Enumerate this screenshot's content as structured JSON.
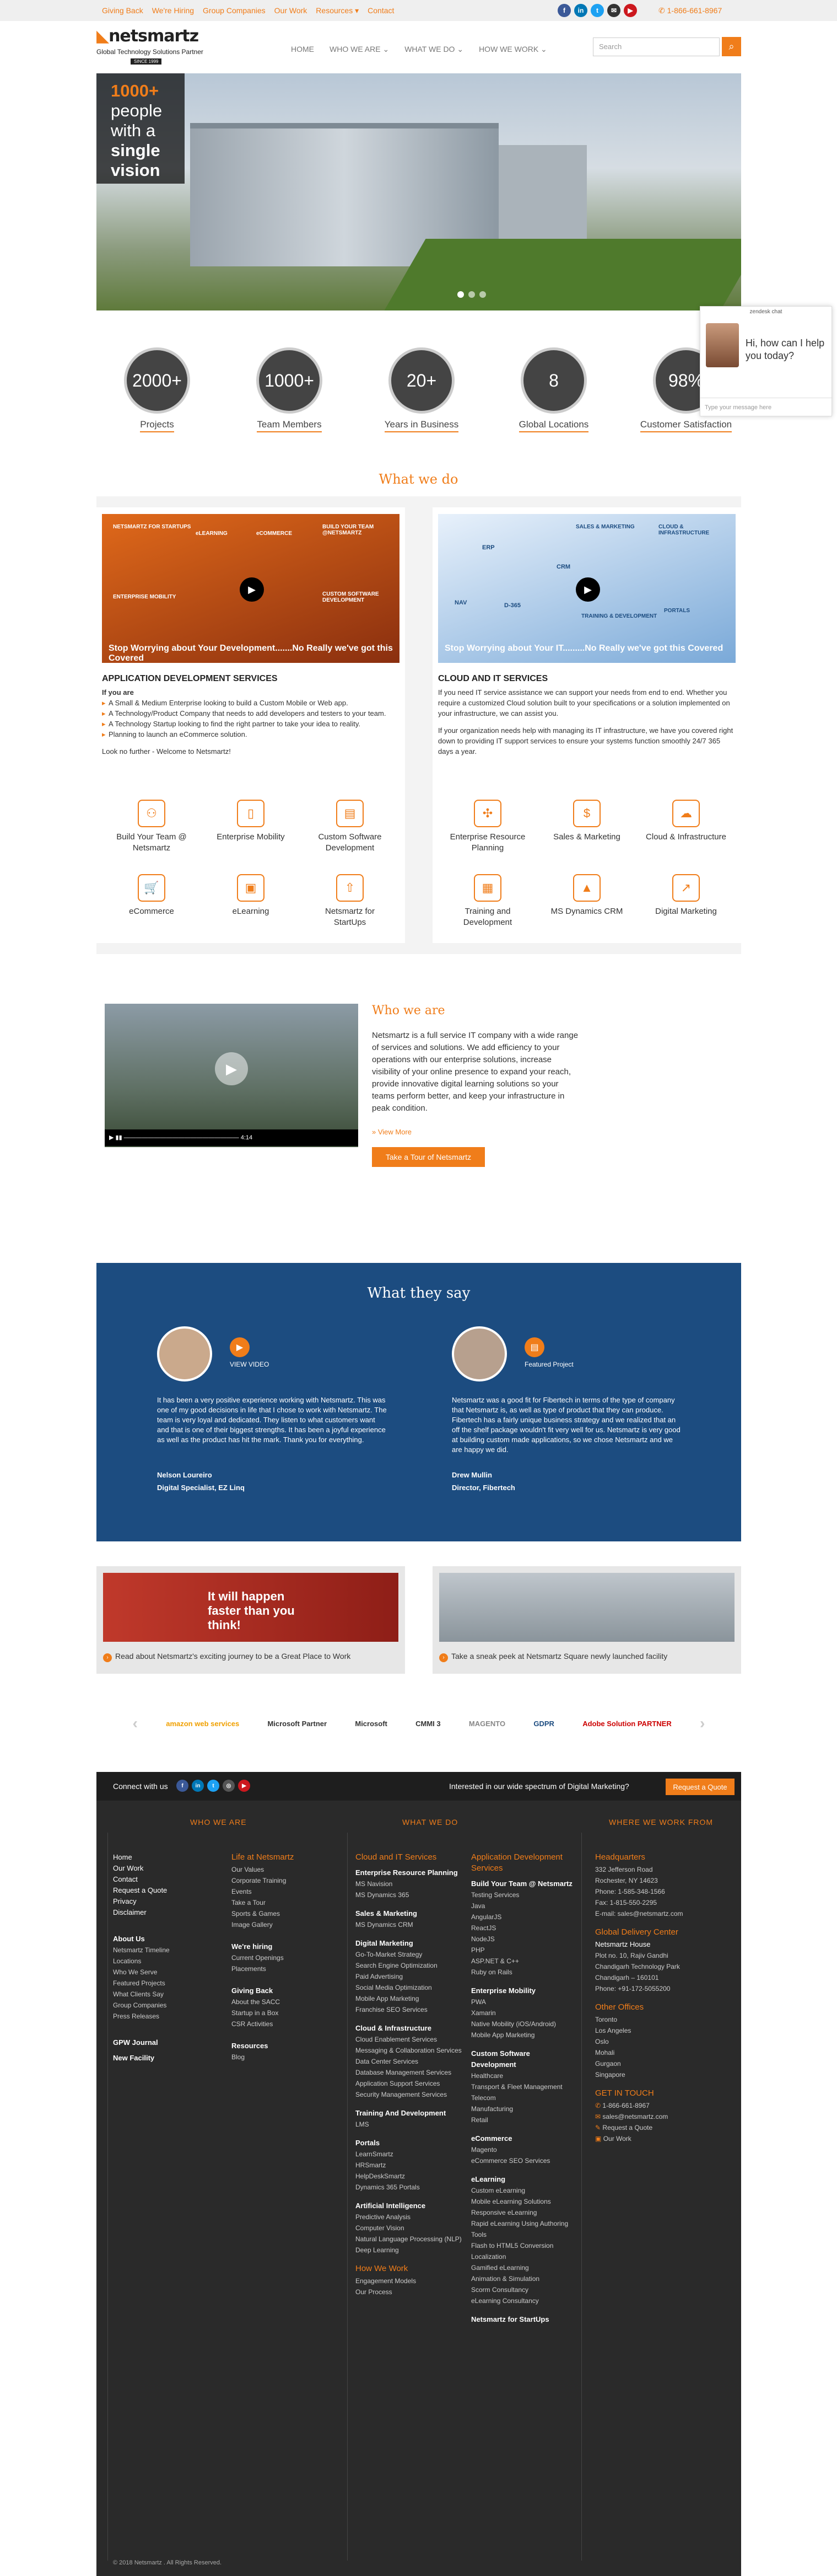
{
  "topbar": {
    "links": [
      "Giving Back",
      "We're Hiring",
      "Group Companies",
      "Our Work",
      "Resources ▾",
      "Contact"
    ],
    "phone": "1-866-661-8967",
    "social": [
      "f",
      "in",
      "t",
      "✉",
      "▶"
    ]
  },
  "header": {
    "logo_name": "netsmartz",
    "logo_tag": "Global Technology Solutions Partner",
    "logo_since": "SINCE 1999",
    "nav": [
      "HOME",
      "WHO WE ARE ⌄",
      "WHAT WE DO ⌄",
      "HOW WE WORK ⌄"
    ],
    "search_placeholder": "Search"
  },
  "hero": {
    "caption_line1": "1000+",
    "caption_rest": "people with a",
    "caption_bold": "single vision"
  },
  "stats": [
    {
      "value": "2000+",
      "label": "Projects"
    },
    {
      "value": "1000+",
      "label": "Team Members"
    },
    {
      "value": "20+",
      "label": "Years in Business"
    },
    {
      "value": "8",
      "label": "Global Locations"
    },
    {
      "value": "98%",
      "label": "Customer Satisfaction"
    }
  ],
  "chat": {
    "header": "zendesk chat",
    "message": "Hi, how can I help you today?",
    "input_placeholder": "Type your message here"
  },
  "what_we_do": {
    "title": "What we do",
    "left": {
      "video_title": "Stop Worrying about Your Development.......No Really we've got this Covered",
      "video_labels": [
        "NETSMARTZ FOR STARTUPS",
        "eLEARNING",
        "eCOMMERCE",
        "BUILD YOUR TEAM @NETSMARTZ",
        "ENTERPRISE MOBILITY",
        "CUSTOM SOFTWARE DEVELOPMENT"
      ],
      "heading": "APPLICATION DEVELOPMENT SERVICES",
      "if_you_are": "If you are",
      "bullets": [
        "A Small & Medium Enterprise looking to build a Custom Mobile or Web app.",
        "A Technology/Product Company that needs to add developers and testers to your team.",
        "A Technology Startup looking to find the right partner to take your idea to reality.",
        "Planning to launch an eCommerce solution."
      ],
      "look": "Look no further - Welcome to Netsmartz!",
      "services": [
        "Build Your Team @ Netsmartz",
        "Enterprise Mobility",
        "Custom Software Development",
        "eCommerce",
        "eLearning",
        "Netsmartz for StartUps"
      ]
    },
    "right": {
      "video_title": "Stop Worrying about Your IT.........No Really we've got this Covered",
      "video_labels": [
        "SALES & MARKETING",
        "CLOUD & INFRASTRUCTURE",
        "ERP",
        "CRM",
        "NAV",
        "D-365",
        "TRAINING & DEVELOPMENT",
        "PORTALS"
      ],
      "heading": "CLOUD AND IT SERVICES",
      "desc": "If you need IT service assistance we can support your needs from end to end. Whether you require a customized Cloud solution built to your specifications or a solution implemented on your infrastructure, we can assist you.",
      "desc2": "If your organization needs help with managing its IT infrastructure, we have you covered right down to providing IT support services to ensure your systems function smoothly 24/7 365 days a year.",
      "services": [
        "Enterprise Resource Planning",
        "Sales & Marketing",
        "Cloud & Infrastructure",
        "Training and Development",
        "MS Dynamics CRM",
        "Digital Marketing"
      ]
    }
  },
  "who_we_are": {
    "title": "Who we are",
    "text": "Netsmartz is a full service IT company with a wide range of services and solutions. We add efficiency to your operations with our enterprise solutions, increase visibility of your online presence to expand your reach, provide innovative digital learning solutions so your teams perform better, and keep your infrastructure in peak condition.",
    "more": "» View More",
    "tour": "Take a Tour of Netsmartz",
    "video_time": "4:14"
  },
  "what_they_say": {
    "title": "What they say",
    "items": [
      {
        "link": "VIEW VIDEO",
        "text": "It has been a very positive experience working with Netsmartz. This was one of my good decisions in life that I chose to work with Netsmartz. The team is very loyal and dedicated. They listen to what customers want and that is one of their biggest strengths. It has been a joyful experience as well as the product has hit the mark. Thank you for everything.",
        "name": "Nelson Loureiro",
        "role": "Digital Specialist, EZ Linq"
      },
      {
        "link": "Featured Project",
        "text": "Netsmartz was a good fit for Fibertech in terms of the type of company that Netsmartz is, as well as type of product that they can produce. Fibertech has a fairly unique business strategy and we realized that an off the shelf package wouldn't fit very well for us. Netsmartz is very good at building custom made applications, so we chose Netsmartz and we are happy we did.",
        "name": "Drew Mullin",
        "role": "Director, Fibertech"
      }
    ]
  },
  "promos": [
    {
      "overlay": "It will happen faster than you think!",
      "caption": "Read about Netsmartz's exciting journey to be a Great Place to Work"
    },
    {
      "caption": "Take a sneak peek at Netsmartz Square newly launched facility"
    }
  ],
  "partners": [
    "amazon web services",
    "Microsoft Partner",
    "Microsoft",
    "CMMI 3",
    "MAGENTO",
    "GDPR",
    "Adobe Solution PARTNER"
  ],
  "footer": {
    "connect": "Connect with us",
    "interested": "Interested in our wide spectrum of Digital Marketing?",
    "quote_btn": "Request a Quote",
    "col_heads": [
      "WHO WE ARE",
      "WHAT WE DO",
      "WHERE WE WORK FROM"
    ],
    "who_main": [
      "Home",
      "Our Work",
      "Contact",
      "Request a Quote",
      "Privacy",
      "Disclaimer"
    ],
    "about_title": "About Us",
    "about": [
      "Netsmartz Timeline",
      "Locations",
      "Who We Serve",
      "Featured Projects",
      "What Clients Say",
      "Group Companies",
      "Press Releases"
    ],
    "gpw": "GPW Journal",
    "newfac": "New Facility",
    "life_title": "Life at Netsmartz",
    "life": [
      "Our Values",
      "Corporate Training",
      "Events",
      "Take a Tour",
      "Sports & Games",
      "Image Gallery"
    ],
    "hiring_title": "We're hiring",
    "hiring": [
      "Current Openings",
      "Placements"
    ],
    "giving_title": "Giving Back",
    "giving": [
      "About the SACC",
      "Startup in a Box",
      "CSR Activities"
    ],
    "res_title": "Resources",
    "res": [
      "Blog"
    ],
    "cloud_title": "Cloud and IT Services",
    "erp_title": "Enterprise Resource Planning",
    "erp": [
      "MS Navision",
      "MS Dynamics 365"
    ],
    "sm_title": "Sales & Marketing",
    "sm": [
      "MS Dynamics CRM"
    ],
    "dm_title": "Digital Marketing",
    "dm": [
      "Go-To-Market Strategy",
      "Search Engine Optimization",
      "Paid Advertising",
      "Social Media Optimization",
      "Mobile App Marketing",
      "Franchise SEO Services"
    ],
    "ci_title": "Cloud & Infrastructure",
    "ci": [
      "Cloud Enablement Services",
      "Messaging & Collaboration Services",
      "Data Center Services",
      "Database Management Services",
      "Application Support Services",
      "Security Management Services"
    ],
    "td_title": "Training And Development",
    "td": [
      "LMS"
    ],
    "portals_title": "Portals",
    "portals": [
      "LearnSmartz",
      "HRSmartz",
      "HelpDeskSmartz",
      "Dynamics 365 Portals"
    ],
    "ai_title": "Artificial Intelligence",
    "ai": [
      "Predictive Analysis",
      "Computer Vision",
      "Natural Language Processing (NLP)",
      "Deep Learning"
    ],
    "hww_title": "How We Work",
    "hww": [
      "Engagement Models",
      "Our Process"
    ],
    "app_title": "Application Development Services",
    "byt_title": "Build Your Team @ Netsmartz",
    "byt": [
      "Testing Services",
      "Java",
      "AngularJS",
      "ReactJS",
      "NodeJS",
      "PHP",
      "ASP.NET & C++",
      "Ruby on Rails"
    ],
    "em_title": "Enterprise Mobility",
    "em": [
      "PWA",
      "Xamarin",
      "Native Mobility (iOS/Android)",
      "Mobile App Marketing"
    ],
    "csd_title": "Custom Software Development",
    "csd": [
      "Healthcare",
      "Transport & Fleet Management",
      "Telecom",
      "Manufacturing",
      "Retail"
    ],
    "ecom_title": "eCommerce",
    "ecom": [
      "Magento",
      "eCommerce SEO Services"
    ],
    "el_title": "eLearning",
    "el": [
      "Custom eLearning",
      "Mobile eLearning Solutions",
      "Responsive eLearning",
      "Rapid eLearning Using Authoring Tools",
      "Flash to HTML5 Conversion",
      "Localization",
      "Gamified eLearning",
      "Animation & Simulation",
      "Scorm Consultancy",
      "eLearning Consultancy"
    ],
    "startups_title": "Netsmartz for StartUps",
    "hq_title": "Headquarters",
    "hq": [
      "332 Jefferson Road",
      "Rochester, NY 14623",
      "Phone: 1-585-348-1566",
      "Fax: 1-815-550-2295",
      "E-mail: sales@netsmartz.com"
    ],
    "gdc_title": "Global Delivery Center",
    "gdc": [
      "Netsmartz House",
      "Plot no. 10, Rajiv Gandhi",
      "Chandigarh Technology Park",
      "Chandigarh – 160101",
      "Phone: +91-172-5055200"
    ],
    "offices_title": "Other Offices",
    "offices": [
      "Toronto",
      "Los Angeles",
      "Oslo",
      "Mohali",
      "Gurgaon",
      "Singapore"
    ],
    "touch_title": "GET IN TOUCH",
    "touch": [
      "1-866-661-8967",
      "sales@netsmartz.com",
      "Request a Quote",
      "Our Work"
    ],
    "copyright": "© 2018 Netsmartz . All Rights Reserved."
  },
  "colors": {
    "accent": "#f07d1a",
    "navy": "#1c4c80",
    "footer": "#2a2a2a"
  }
}
